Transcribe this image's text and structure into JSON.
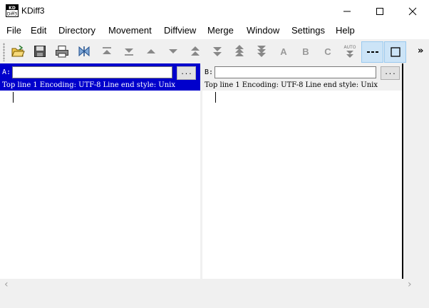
{
  "window": {
    "title": "KDiff3",
    "icon_text_top": "KD",
    "icon_text_bottom": "Diff3"
  },
  "menubar": {
    "items": [
      {
        "label": "File"
      },
      {
        "label": "Edit"
      },
      {
        "label": "Directory"
      },
      {
        "label": "Movement"
      },
      {
        "label": "Diffview"
      },
      {
        "label": "Merge"
      },
      {
        "label": "Window"
      },
      {
        "label": "Settings"
      },
      {
        "label": "Help"
      }
    ]
  },
  "toolbar": {
    "icons": [
      "open-folder-icon",
      "save-icon",
      "print-icon",
      "merge-icon",
      "go-top-icon",
      "go-bottom-icon",
      "go-prev-delta-icon",
      "go-next-delta-icon",
      "go-prev-conflict-icon",
      "go-next-conflict-icon",
      "go-prev-unsolved-icon",
      "go-next-unsolved-icon",
      "select-a-icon",
      "select-b-icon",
      "select-c-icon",
      "auto-advance-icon",
      "split-diff-icon",
      "show-window-icon"
    ],
    "letter_a": "A",
    "letter_b": "B",
    "letter_c": "C",
    "auto_label": "AUTO",
    "overflow_label": "»",
    "active_color": "#cce4f7"
  },
  "pane_a": {
    "label": "A:",
    "path_value": "",
    "browse_label": "...",
    "top_line": "Top line 1",
    "encoding": "Encoding: UTF-8",
    "line_end": "Line end style: Unix",
    "active": true,
    "header_color": "#0000cc"
  },
  "pane_b": {
    "label": "B:",
    "path_value": "",
    "browse_label": "...",
    "top_line": "Top line 1",
    "encoding": "Encoding: UTF-8",
    "line_end": "Line end style: Unix",
    "active": false,
    "header_color": "#f0f0f0"
  },
  "scrollbar": {
    "left_arrow": "‹",
    "right_arrow": "›"
  }
}
